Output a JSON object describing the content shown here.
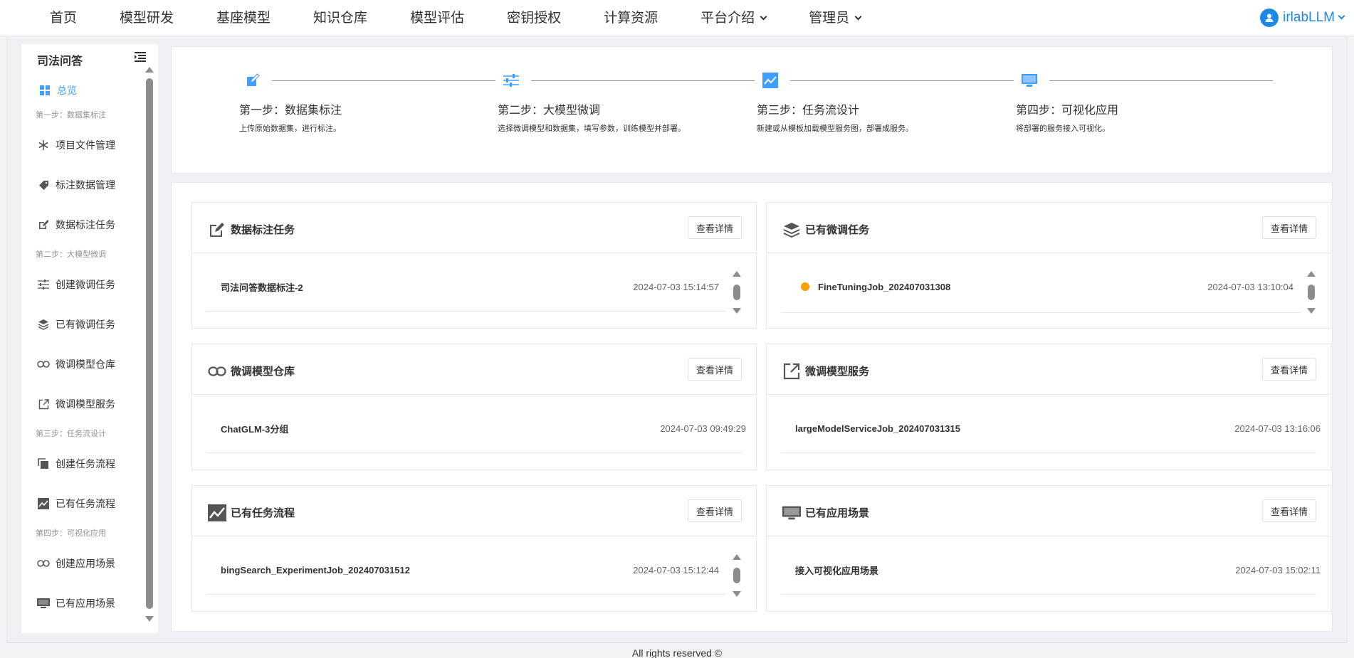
{
  "nav": {
    "items": [
      {
        "label": "首页",
        "dropdown": false
      },
      {
        "label": "模型研发",
        "dropdown": false
      },
      {
        "label": "基座模型",
        "dropdown": false
      },
      {
        "label": "知识仓库",
        "dropdown": false
      },
      {
        "label": "模型评估",
        "dropdown": false
      },
      {
        "label": "密钥授权",
        "dropdown": false
      },
      {
        "label": "计算资源",
        "dropdown": false
      },
      {
        "label": "平台介绍",
        "dropdown": true
      },
      {
        "label": "管理员",
        "dropdown": true
      }
    ],
    "user": "irlabLLM"
  },
  "sidebar": {
    "title": "司法问答",
    "overview": "总览",
    "groups": [
      {
        "label": "第一步：数据集标注",
        "items": [
          "项目文件管理",
          "标注数据管理",
          "数据标注任务"
        ]
      },
      {
        "label": "第二步：大模型微调",
        "items": [
          "创建微调任务",
          "已有微调任务",
          "微调模型仓库",
          "微调模型服务"
        ]
      },
      {
        "label": "第三步：任务流设计",
        "items": [
          "创建任务流程",
          "已有任务流程"
        ]
      },
      {
        "label": "第四步：可视化应用",
        "items": [
          "创建应用场景",
          "已有应用场景"
        ]
      }
    ]
  },
  "steps": [
    {
      "title": "第一步：数据集标注",
      "desc": "上传原始数据集，进行标注。",
      "icon": "edit-icon"
    },
    {
      "title": "第二步：大模型微调",
      "desc": "选择微调模型和数据集，填写参数，训练模型并部署。",
      "icon": "sliders-icon"
    },
    {
      "title": "第三步：任务流设计",
      "desc": "新建或从模板加载模型服务图，部署成服务。",
      "icon": "chart-line-icon"
    },
    {
      "title": "第四步：可视化应用",
      "desc": "将部署的服务接入可视化。",
      "icon": "monitor-icon"
    }
  ],
  "cards": {
    "detail_label": "查看详情",
    "annotation": {
      "title": "数据标注任务",
      "name": "司法问答数据标注-2",
      "time": "2024-07-03 15:14:57"
    },
    "finetune": {
      "title": "已有微调任务",
      "name": "FineTuningJob_202407031308",
      "time": "2024-07-03 13:10:04"
    },
    "repo": {
      "title": "微调模型仓库",
      "name": "ChatGLM-3分组",
      "time": "2024-07-03 09:49:29"
    },
    "service": {
      "title": "微调模型服务",
      "name": "largeModelServiceJob_202407031315",
      "time": "2024-07-03 13:16:06"
    },
    "flow": {
      "title": "已有任务流程",
      "name": "bingSearch_ExperimentJob_202407031512",
      "time": "2024-07-03 15:12:44"
    },
    "scene": {
      "title": "已有应用场景",
      "name": "接入可视化应用场景",
      "time": "2024-07-03 15:02:11"
    }
  },
  "colors": {
    "accent": "#409eff",
    "user": "#1e88e5",
    "status_running": "#f5a000"
  },
  "footer": "All rights reserved ©"
}
